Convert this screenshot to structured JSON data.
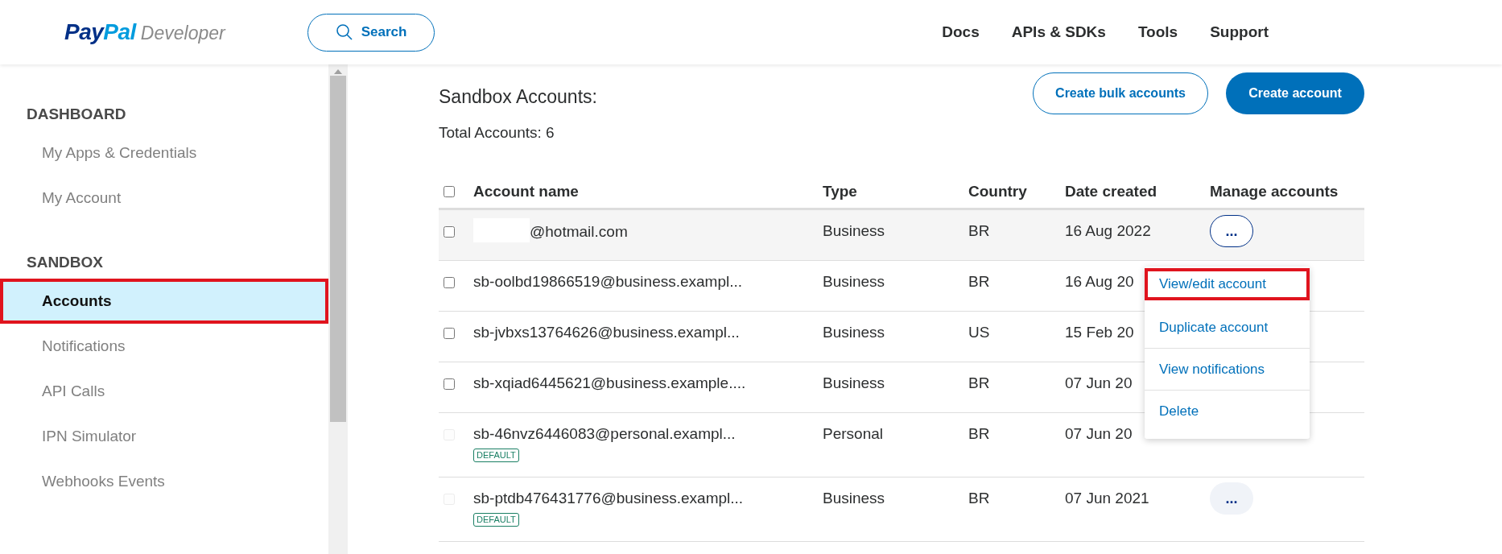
{
  "header": {
    "logo": {
      "parts": [
        "Pay",
        "Pal"
      ],
      "product": "Developer"
    },
    "search": {
      "label": "Search"
    },
    "nav": [
      "Docs",
      "APIs & SDKs",
      "Tools",
      "Support"
    ]
  },
  "sidebar": {
    "sections": [
      {
        "title": "DASHBOARD",
        "items": [
          {
            "label": "My Apps & Credentials",
            "selected": false,
            "highlighted": false
          },
          {
            "label": "My Account",
            "selected": false,
            "highlighted": false
          }
        ]
      },
      {
        "title": "SANDBOX",
        "items": [
          {
            "label": "Accounts",
            "selected": true,
            "highlighted": true
          },
          {
            "label": "Notifications",
            "selected": false,
            "highlighted": false
          },
          {
            "label": "API Calls",
            "selected": false,
            "highlighted": false
          },
          {
            "label": "IPN Simulator",
            "selected": false,
            "highlighted": false
          },
          {
            "label": "Webhooks Events",
            "selected": false,
            "highlighted": false
          }
        ]
      }
    ]
  },
  "main": {
    "title": "Sandbox Accounts:",
    "total": "Total Accounts: 6",
    "buttons": [
      {
        "label": "Create bulk accounts",
        "kind": "outline"
      },
      {
        "label": "Create account",
        "kind": "primary"
      }
    ]
  },
  "table": {
    "select_all": {
      "checked": false
    },
    "columns": [
      "Account name",
      "Type",
      "Country",
      "Date created",
      "Manage accounts"
    ],
    "rows": [
      {
        "name": "@hotmail.com",
        "redacted": true,
        "type": "Business",
        "country": "BR",
        "date": "16 Aug 2022",
        "disabled": false,
        "checked": false,
        "hovered": true,
        "badge": null,
        "manage": {
          "label": "...",
          "active": true
        }
      },
      {
        "name": "sb-oolbd19866519@business.exampl...",
        "redacted": false,
        "type": "Business",
        "country": "BR",
        "date": "16 Aug 20",
        "disabled": false,
        "checked": false,
        "hovered": false,
        "badge": null,
        "manage": null
      },
      {
        "name": "sb-jvbxs13764626@business.exampl...",
        "redacted": false,
        "type": "Business",
        "country": "US",
        "date": "15 Feb 20",
        "disabled": false,
        "checked": false,
        "hovered": false,
        "badge": null,
        "manage": null
      },
      {
        "name": "sb-xqiad6445621@business.example....",
        "redacted": false,
        "type": "Business",
        "country": "BR",
        "date": "07 Jun 20",
        "disabled": false,
        "checked": false,
        "hovered": false,
        "badge": null,
        "manage": null
      },
      {
        "name": "sb-46nvz6446083@personal.exampl...",
        "redacted": false,
        "type": "Personal",
        "country": "BR",
        "date": "07 Jun 20",
        "disabled": true,
        "checked": false,
        "hovered": false,
        "badge": "DEFAULT",
        "manage": null
      },
      {
        "name": "sb-ptdb476431776@business.exampl...",
        "redacted": false,
        "type": "Business",
        "country": "BR",
        "date": "07 Jun 2021",
        "disabled": true,
        "checked": false,
        "hovered": false,
        "badge": "DEFAULT",
        "manage": {
          "label": "...",
          "active": false
        }
      }
    ]
  },
  "menu": {
    "items": [
      {
        "label": "View/edit account",
        "highlighted": true
      },
      {
        "label": "Duplicate account",
        "highlighted": false
      },
      {
        "label": "View notifications",
        "highlighted": false
      },
      {
        "label": "Delete",
        "highlighted": false
      }
    ]
  }
}
